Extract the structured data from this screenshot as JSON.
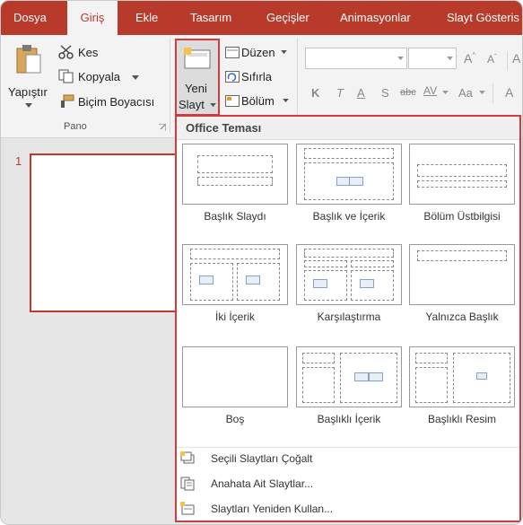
{
  "tabs": [
    {
      "label": "Dosya"
    },
    {
      "label": "Giriş"
    },
    {
      "label": "Ekle"
    },
    {
      "label": "Tasarım"
    },
    {
      "label": "Geçişler"
    },
    {
      "label": "Animasyonlar"
    },
    {
      "label": "Slayt Gösteris"
    }
  ],
  "pano": {
    "paste": "Yapıştır",
    "cut": "Kes",
    "copy": "Kopyala",
    "format_painter": "Biçim Boyacısı",
    "group": "Pano"
  },
  "slides": {
    "new_line1": "Yeni",
    "new_line2": "Slayt",
    "layout": "Düzen",
    "reset": "Sıfırla",
    "section": "Bölüm"
  },
  "font": {
    "bold": "K",
    "italic": "T",
    "underline": "A",
    "shadow": "S",
    "strike": "abc",
    "spacing": "AV",
    "case": "Aa"
  },
  "slide_panel": {
    "number": "1"
  },
  "gallery": {
    "title": "Office Teması",
    "layouts": [
      {
        "label": "Başlık Slaydı"
      },
      {
        "label": "Başlık ve İçerik"
      },
      {
        "label": "Bölüm Üstbilgisi"
      },
      {
        "label": "İki İçerik"
      },
      {
        "label": "Karşılaştırma"
      },
      {
        "label": "Yalnızca Başlık"
      },
      {
        "label": "Boş"
      },
      {
        "label": "Başlıklı İçerik"
      },
      {
        "label": "Başlıklı Resim"
      }
    ],
    "menu": [
      {
        "label": "Seçili Slaytları Çoğalt"
      },
      {
        "label": "Anahata Ait Slaytlar..."
      },
      {
        "label": "Slaytları Yeniden Kullan..."
      }
    ]
  },
  "colors": {
    "accent": "#b83a2b",
    "highlight": "#d33c3c"
  }
}
